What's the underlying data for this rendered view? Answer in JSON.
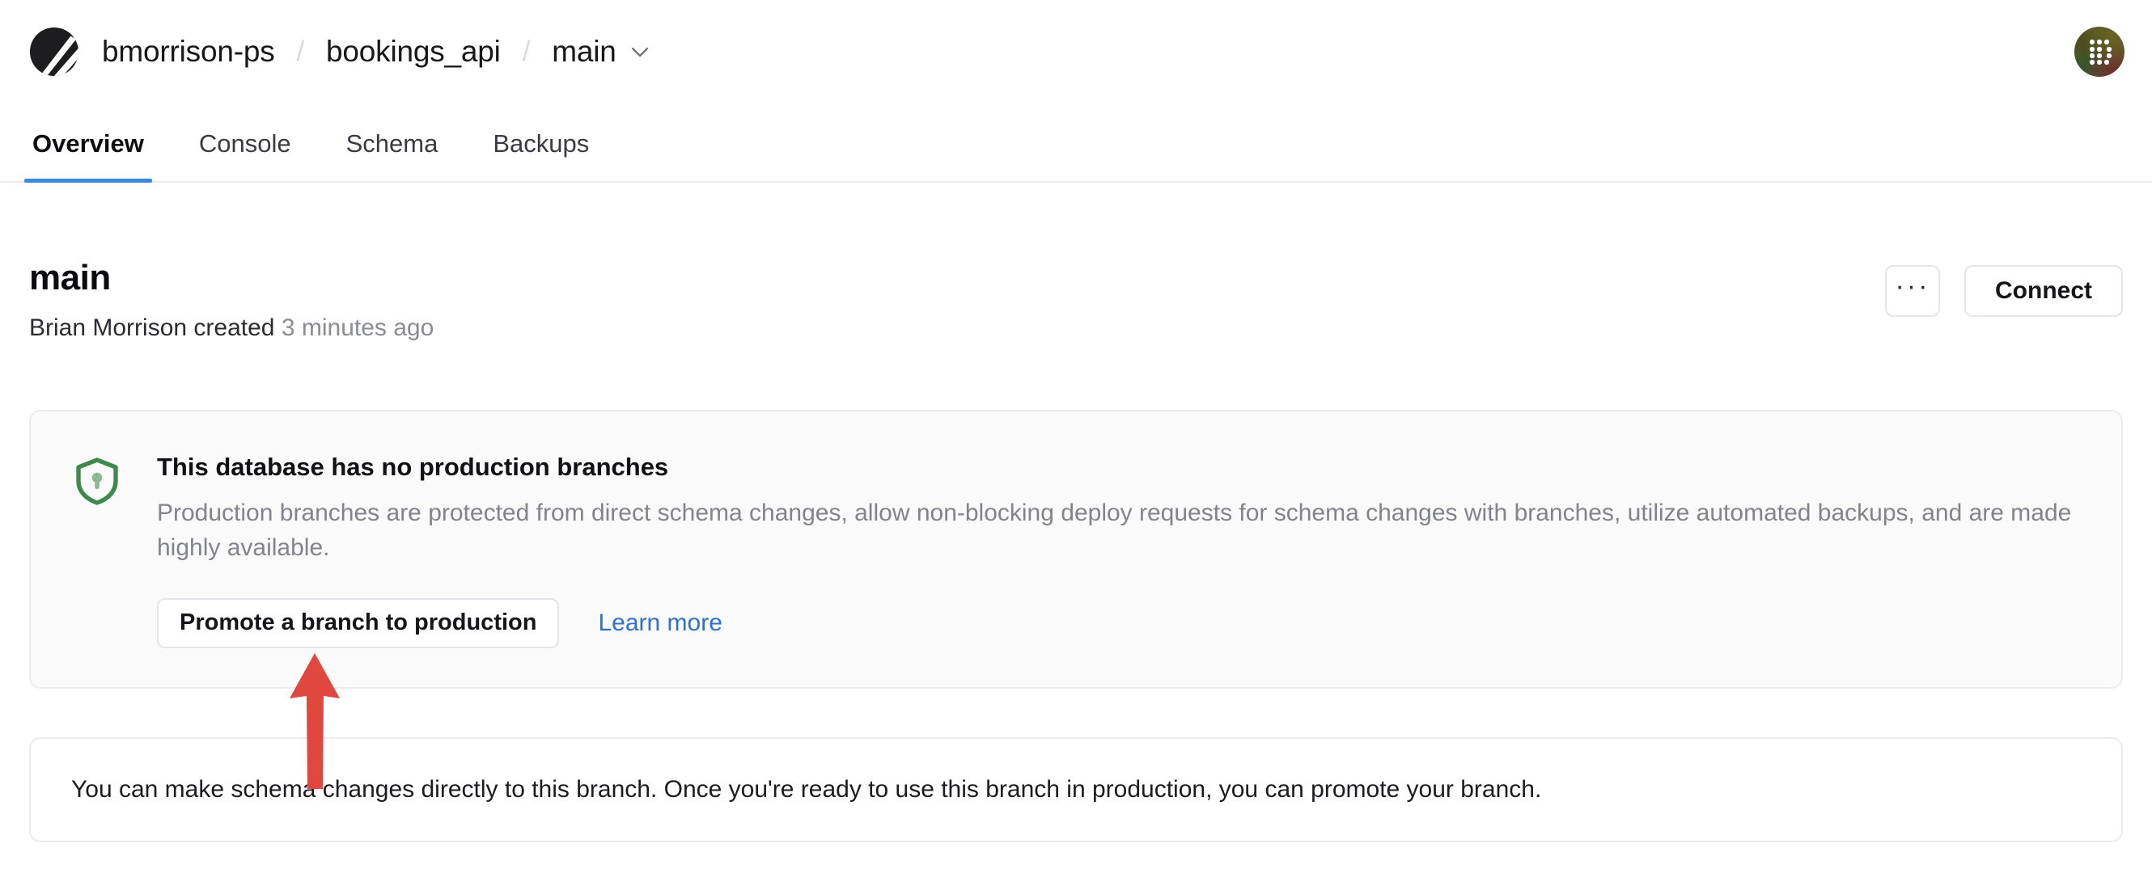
{
  "topbar": {
    "logo_icon": "planetscale-logo-icon",
    "breadcrumb": {
      "org": "bmorrison-ps",
      "database": "bookings_api",
      "branch": "main",
      "separator": "/",
      "branch_chevron_icon": "chevron-down-icon"
    },
    "avatar_label": "user-avatar"
  },
  "tabs": [
    {
      "label": "Overview",
      "active": true
    },
    {
      "label": "Console",
      "active": false
    },
    {
      "label": "Schema",
      "active": false
    },
    {
      "label": "Backups",
      "active": false
    }
  ],
  "page_head": {
    "title": "main",
    "created_by": "Brian Morrison",
    "created_verb": "created",
    "created_when": "3 minutes ago",
    "more_button_label": "···",
    "connect_button_label": "Connect"
  },
  "notice": {
    "icon": "shield-keyhole-icon",
    "title": "This database has no production branches",
    "body": "Production branches are protected from direct schema changes, allow non-blocking deploy requests for schema changes with branches, utilize automated backups, and are made highly available.",
    "promote_button_label": "Promote a branch to production",
    "learn_more_label": "Learn more"
  },
  "info_card": {
    "text": "You can make schema changes directly to this branch. Once you're ready to use this branch in production, you can promote your branch."
  },
  "annotation": {
    "name": "red-arrow-annotation",
    "points_at": "Promote a branch to production",
    "color": "#e0483f"
  },
  "colors": {
    "accent_blue": "#3c8ad9",
    "link_blue": "#2f6fd0",
    "shield_green": "#3f8a4a",
    "border": "#ececef",
    "notice_bg": "#fafafa",
    "muted_text": "#83838c"
  }
}
